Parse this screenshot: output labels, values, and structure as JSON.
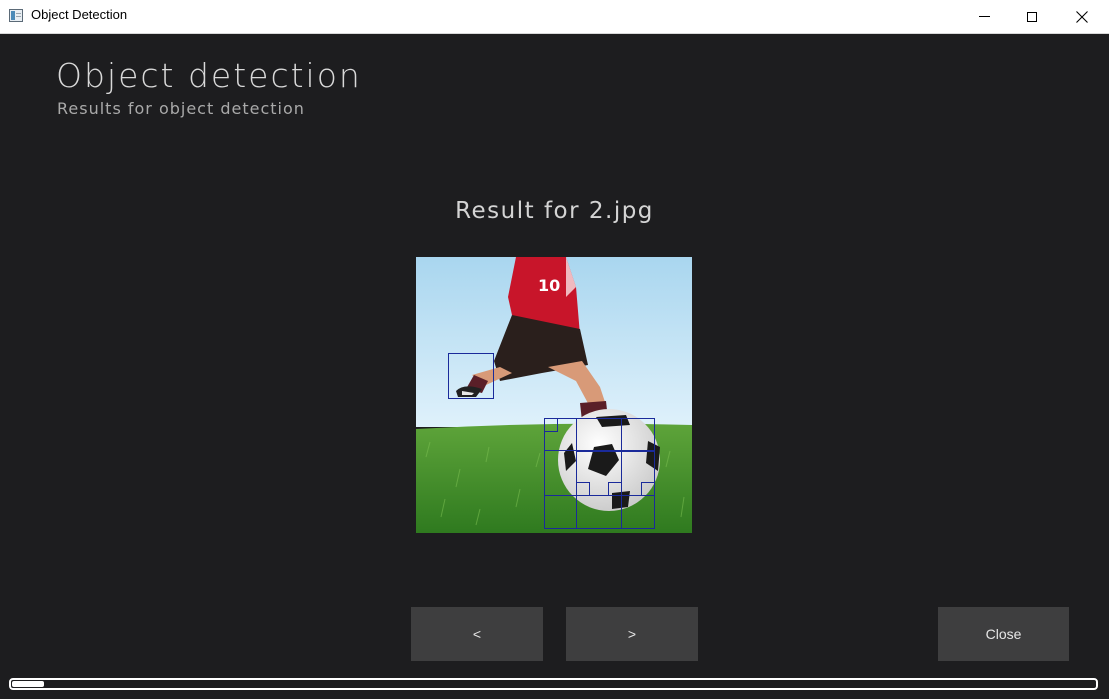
{
  "window": {
    "title": "Object Detection",
    "icons": {
      "app": "app-window-icon",
      "minimize": "minimize-icon",
      "maximize": "maximize-icon",
      "close": "close-icon"
    }
  },
  "header": {
    "title": "Object detection",
    "subtitle": "Results for object detection"
  },
  "result": {
    "title": "Result for 2.jpg",
    "image_description_icon": "photo-soccer-player-kicking-ball"
  },
  "buttons": {
    "prev_label": "<",
    "next_label": ">",
    "close_label": "Close"
  },
  "progress": {
    "fraction": 0.03
  },
  "colors": {
    "background": "#1d1d1f",
    "button": "#3e3e3f",
    "detection_box": "#1a2a9a"
  }
}
